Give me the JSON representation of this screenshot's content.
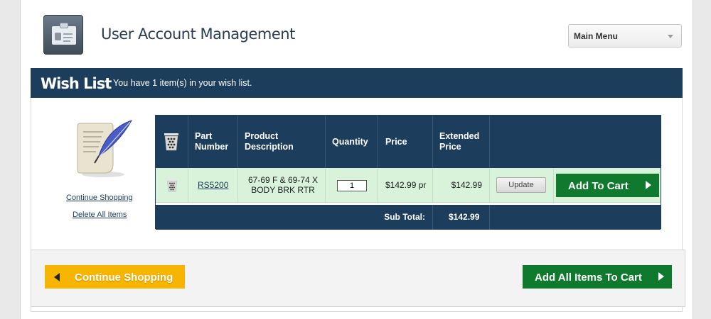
{
  "header": {
    "title": "User Account Management",
    "menu_label": "Main Menu",
    "icon": "account-card-icon"
  },
  "wishlist": {
    "title": "Wish List",
    "message": "You have 1 item(s) in your wish list.",
    "continue_link": "Continue Shopping",
    "delete_all_link": "Delete All Items"
  },
  "table": {
    "headers": {
      "part_number": "Part Number",
      "product_description": "Product Description",
      "quantity": "Quantity",
      "price": "Price",
      "extended_price": "Extended Price"
    },
    "rows": [
      {
        "part_number": "RS5200",
        "description": "67-69 F & 69-74 X BODY BRK RTR",
        "quantity": "1",
        "price": "$142.99 pr",
        "extended_price": "$142.99",
        "update_label": "Update",
        "add_label": "Add To Cart"
      }
    ],
    "subtotal_label": "Sub Total:",
    "subtotal_value": "$142.99"
  },
  "actions": {
    "continue_label": "Continue Shopping",
    "add_all_label": "Add All Items To Cart"
  },
  "colors": {
    "navy": "#1d3d5c",
    "green": "#0f7a2e",
    "yellow": "#f7b500",
    "row_green": "#d8f3da"
  }
}
